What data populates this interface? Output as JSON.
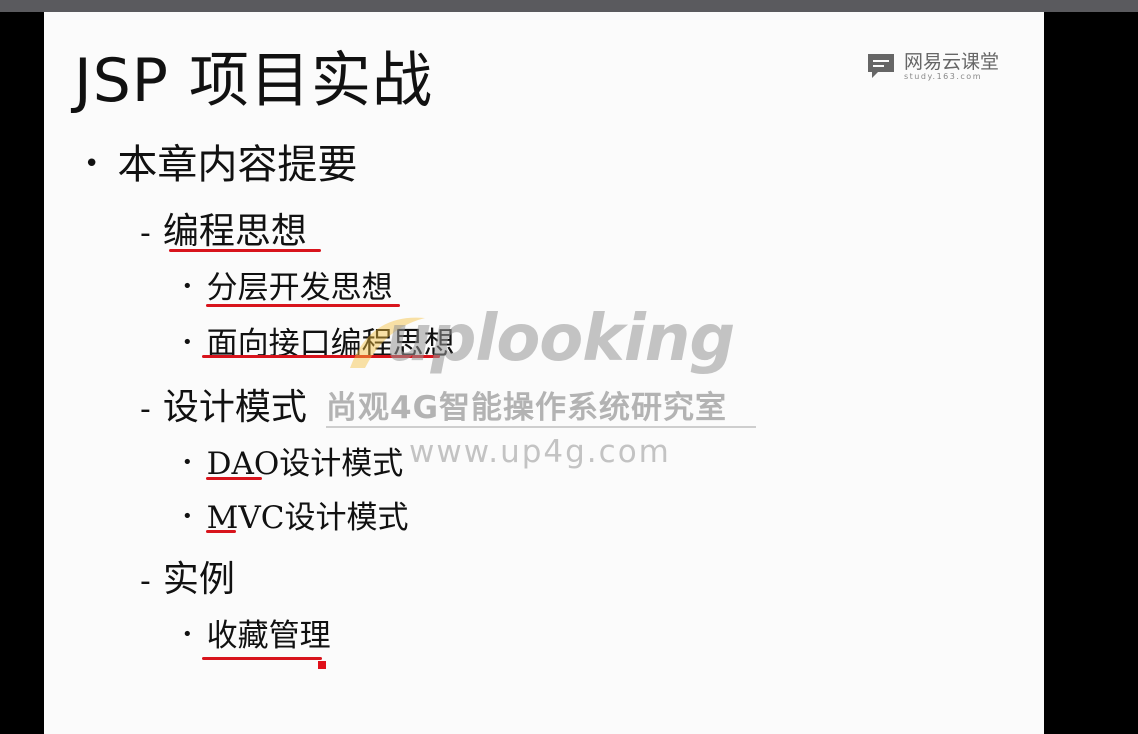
{
  "slide": {
    "title": "JSP 项目实战",
    "brand": {
      "name": "网易云课堂",
      "url": "study.163.com"
    },
    "outline": {
      "heading": "本章内容提要",
      "sections": [
        {
          "label": "编程思想",
          "items": [
            "分层开发思想",
            "面向接口编程思想"
          ]
        },
        {
          "label": "设计模式",
          "items": [
            "DAO设计模式",
            "MVC设计模式"
          ]
        },
        {
          "label": "实例",
          "items": [
            "收藏管理"
          ]
        }
      ]
    },
    "watermark": {
      "logo": "uplooking",
      "tagline": "尚观4G智能操作系统研究室",
      "url": "www.up4g.com"
    }
  },
  "colors": {
    "annotation": "#d8141c",
    "slide_bg": "#fbfbfb",
    "frame": "#000000"
  }
}
